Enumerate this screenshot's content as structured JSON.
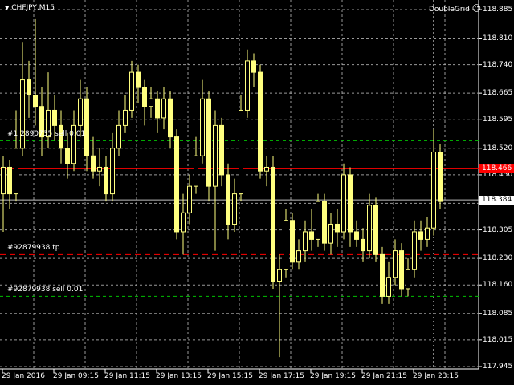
{
  "header": {
    "symbol": "CHFJPY,M15",
    "indicator": "DoubleGrid"
  },
  "price_scale": [
    "118.885",
    "118.810",
    "118.740",
    "118.665",
    "118.595",
    "118.520",
    "118.450",
    "118.375",
    "118.305",
    "118.230",
    "118.160",
    "118.085",
    "118.015",
    "117.945"
  ],
  "time_axis": [
    "29 Jan 2016",
    "29 Jan 09:15",
    "29 Jan 11:15",
    "29 Jan 13:15",
    "29 Jan 15:15",
    "29 Jan 17:15",
    "29 Jan 19:15",
    "29 Jan 21:15",
    "29 Jan 23:15"
  ],
  "lines": {
    "ask": {
      "price": 118.466,
      "label": "118.466",
      "color": "#ff0000"
    },
    "bid": {
      "price": 118.384,
      "label": "118.384",
      "color": "#c0c0c0"
    }
  },
  "orders": [
    {
      "label": "#1 2890735 sell 0.01",
      "price": 118.54,
      "color": "#00c000"
    },
    {
      "label": "#92879938 tp",
      "price": 118.24,
      "color": "#ff0000"
    },
    {
      "label": "#92879938 sell 0.01",
      "price": 118.13,
      "color": "#00c000"
    }
  ],
  "colors": {
    "candle": "#ffff80",
    "grid": "#c0c0c0"
  },
  "chart_data": {
    "type": "candlestick",
    "ylim": [
      117.945,
      118.885
    ],
    "candles": [
      [
        118.4,
        118.5,
        118.3,
        118.47
      ],
      [
        118.47,
        118.49,
        118.36,
        118.4
      ],
      [
        118.4,
        118.62,
        118.38,
        118.52
      ],
      [
        118.52,
        118.8,
        118.5,
        118.7
      ],
      [
        118.7,
        118.75,
        118.6,
        118.66
      ],
      [
        118.66,
        118.86,
        118.58,
        118.63
      ],
      [
        118.63,
        118.68,
        118.5,
        118.55
      ],
      [
        118.55,
        118.72,
        118.52,
        118.62
      ],
      [
        118.62,
        118.66,
        118.54,
        118.58
      ],
      [
        118.58,
        118.62,
        118.48,
        118.52
      ],
      [
        118.52,
        118.56,
        118.44,
        118.48
      ],
      [
        118.48,
        118.62,
        118.46,
        118.58
      ],
      [
        118.58,
        118.7,
        118.55,
        118.65
      ],
      [
        118.65,
        118.68,
        118.46,
        118.5
      ],
      [
        118.5,
        118.55,
        118.44,
        118.46
      ],
      [
        118.46,
        118.52,
        118.42,
        118.47
      ],
      [
        118.47,
        118.5,
        118.38,
        118.4
      ],
      [
        118.4,
        118.56,
        118.38,
        118.52
      ],
      [
        118.52,
        118.62,
        118.5,
        118.58
      ],
      [
        118.58,
        118.66,
        118.56,
        118.62
      ],
      [
        118.62,
        118.75,
        118.6,
        118.72
      ],
      [
        118.72,
        118.74,
        118.64,
        118.68
      ],
      [
        118.68,
        118.7,
        118.58,
        118.63
      ],
      [
        118.63,
        118.68,
        118.6,
        118.65
      ],
      [
        118.65,
        118.67,
        118.56,
        118.6
      ],
      [
        118.6,
        118.68,
        118.57,
        118.65
      ],
      [
        118.65,
        118.67,
        118.52,
        118.55
      ],
      [
        118.55,
        118.57,
        118.28,
        118.3
      ],
      [
        118.3,
        118.4,
        118.24,
        118.35
      ],
      [
        118.35,
        118.45,
        118.32,
        118.42
      ],
      [
        118.42,
        118.55,
        118.4,
        118.5
      ],
      [
        118.5,
        118.7,
        118.48,
        118.65
      ],
      [
        118.65,
        118.67,
        118.38,
        118.42
      ],
      [
        118.42,
        118.62,
        118.25,
        118.58
      ],
      [
        118.58,
        118.6,
        118.42,
        118.45
      ],
      [
        118.45,
        118.48,
        118.28,
        118.32
      ],
      [
        118.32,
        118.44,
        118.3,
        118.4
      ],
      [
        118.4,
        118.66,
        118.38,
        118.62
      ],
      [
        118.62,
        118.78,
        118.6,
        118.75
      ],
      [
        118.75,
        118.77,
        118.68,
        118.72
      ],
      [
        118.72,
        118.74,
        118.44,
        118.46
      ],
      [
        118.46,
        118.5,
        118.42,
        118.47
      ],
      [
        118.47,
        118.5,
        118.15,
        118.17
      ],
      [
        118.17,
        118.24,
        117.97,
        118.2
      ],
      [
        118.2,
        118.36,
        118.18,
        118.33
      ],
      [
        118.33,
        118.35,
        118.2,
        118.22
      ],
      [
        118.22,
        118.28,
        118.2,
        118.25
      ],
      [
        118.25,
        118.33,
        118.22,
        118.3
      ],
      [
        118.3,
        118.36,
        118.25,
        118.28
      ],
      [
        118.28,
        118.4,
        118.26,
        118.38
      ],
      [
        118.38,
        118.4,
        118.25,
        118.27
      ],
      [
        118.27,
        118.35,
        118.24,
        118.32
      ],
      [
        118.32,
        118.36,
        118.26,
        118.3
      ],
      [
        118.3,
        118.48,
        118.28,
        118.45
      ],
      [
        118.45,
        118.47,
        118.26,
        118.3
      ],
      [
        118.3,
        118.33,
        118.26,
        118.28
      ],
      [
        118.28,
        118.31,
        118.22,
        118.25
      ],
      [
        118.25,
        118.4,
        118.23,
        118.37
      ],
      [
        118.37,
        118.39,
        118.22,
        118.24
      ],
      [
        118.24,
        118.26,
        118.11,
        118.13
      ],
      [
        118.13,
        118.22,
        118.11,
        118.18
      ],
      [
        118.18,
        118.28,
        118.16,
        118.25
      ],
      [
        118.25,
        118.27,
        118.13,
        118.15
      ],
      [
        118.15,
        118.23,
        118.13,
        118.2
      ],
      [
        118.2,
        118.33,
        118.18,
        118.3
      ],
      [
        118.3,
        118.33,
        118.25,
        118.28
      ],
      [
        118.28,
        118.34,
        118.26,
        118.31
      ],
      [
        118.31,
        118.57,
        118.29,
        118.51
      ],
      [
        118.51,
        118.53,
        118.36,
        118.38
      ]
    ]
  }
}
